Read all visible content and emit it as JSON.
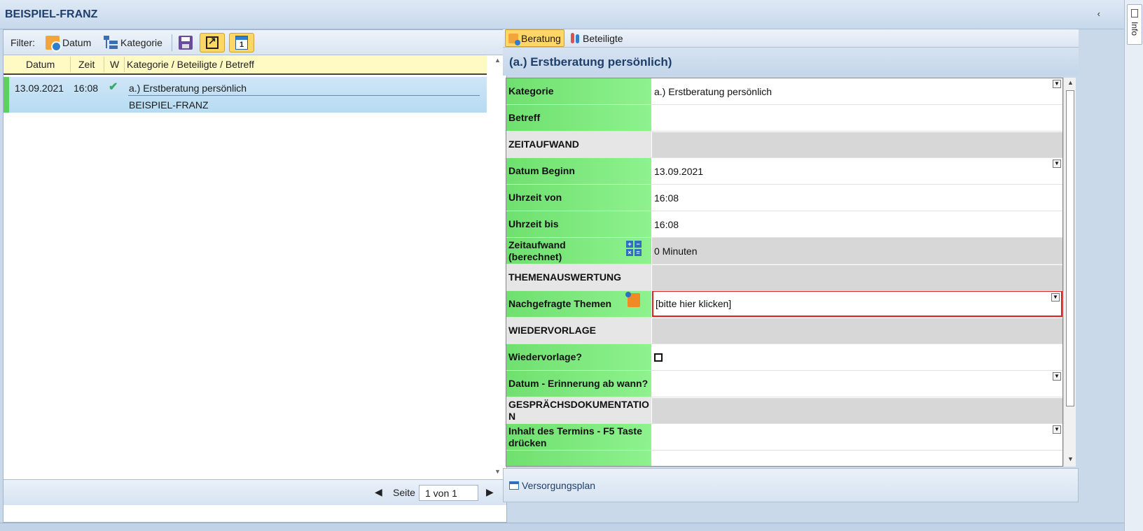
{
  "window": {
    "title": "BEISPIEL-FRANZ",
    "collapse_glyph": "‹",
    "info_tab": "Info"
  },
  "toolbar": {
    "filter_label": "Filter:",
    "datum_label": "Datum",
    "kategorie_label": "Kategorie",
    "day_icon_text": "1"
  },
  "grid": {
    "columns": [
      "Datum",
      "Zeit",
      "W",
      "Kategorie / Beteiligte / Betreff"
    ],
    "rows": [
      {
        "datum": "13.09.2021",
        "zeit": "16:08",
        "check": "✔",
        "kategorie": "a.) Erstberatung persönlich",
        "beteiligte": "BEISPIEL-FRANZ"
      }
    ]
  },
  "pager": {
    "label": "Seite",
    "value": "1 von 1",
    "prev": "◀",
    "next": "▶"
  },
  "tabs": {
    "beratung": "Beratung",
    "beteiligte": "Beteiligte"
  },
  "section_title": "(a.) Erstberatung persönlich)",
  "form": {
    "kategorie": {
      "label": "Kategorie",
      "value": "a.) Erstberatung persönlich"
    },
    "betreff": {
      "label": "Betreff",
      "value": ""
    },
    "zeitaufwand_section": {
      "label": "ZEITAUFWAND"
    },
    "datum_beginn": {
      "label": "Datum Beginn",
      "value": "13.09.2021"
    },
    "uhrzeit_von": {
      "label": "Uhrzeit von",
      "value": "16:08"
    },
    "uhrzeit_bis": {
      "label": "Uhrzeit bis",
      "value": "16:08"
    },
    "zeitaufwand": {
      "label": "Zeitaufwand (berechnet)",
      "value": "0 Minuten"
    },
    "themen_section": {
      "label": "THEMENAUSWERTUNG"
    },
    "themen": {
      "label": "Nachgefragte Themen",
      "value": "[bitte hier klicken]"
    },
    "wiedervorlage_section": {
      "label": "WIEDERVORLAGE"
    },
    "wiedervorlage": {
      "label": "Wiedervorlage?"
    },
    "erinnerung": {
      "label": "Datum - Erinnerung ab wann?",
      "value": ""
    },
    "doku_section": {
      "label": "GESPRÄCHSDOKUMENTATION"
    },
    "inhalt": {
      "label": "Inhalt des Termins - F5 Taste drücken",
      "value": ""
    }
  },
  "bottom": {
    "link": "Versorgungsplan"
  }
}
